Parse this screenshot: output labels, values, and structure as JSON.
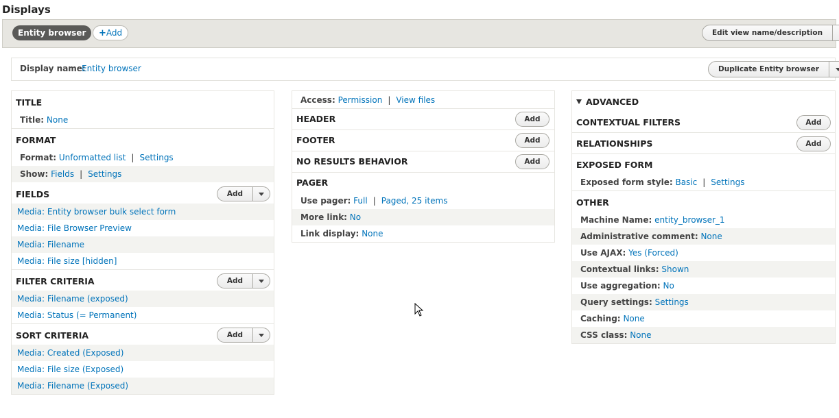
{
  "page_title": "Displays",
  "tabs": {
    "current": "Entity browser",
    "add": "Add"
  },
  "edit_button": "Edit view name/description",
  "display_name": {
    "label": "Display name:",
    "value": "Entity browser"
  },
  "duplicate_button": "Duplicate Entity browser",
  "left": {
    "title": {
      "header": "TITLE",
      "label": "Title:",
      "value": "None"
    },
    "format": {
      "header": "FORMAT",
      "format_label": "Format:",
      "format_value": "Unformatted list",
      "format_settings": "Settings",
      "show_label": "Show:",
      "show_value": "Fields",
      "show_settings": "Settings"
    },
    "fields": {
      "header": "FIELDS",
      "add": "Add",
      "items": [
        "Media: Entity browser bulk select form",
        "Media: File Browser Preview",
        "Media: Filename",
        "Media: File size [hidden]"
      ]
    },
    "filter": {
      "header": "FILTER CRITERIA",
      "add": "Add",
      "items": [
        "Media: Filename (exposed)",
        "Media: Status (= Permanent)"
      ]
    },
    "sort": {
      "header": "SORT CRITERIA",
      "add": "Add",
      "items": [
        "Media: Created (Exposed)",
        "Media: File size (Exposed)",
        "Media: Filename (Exposed)"
      ]
    }
  },
  "middle": {
    "access_label": "Access:",
    "access_value": "Permission",
    "access_extra": "View files",
    "header": {
      "title": "HEADER",
      "add": "Add"
    },
    "footer": {
      "title": "FOOTER",
      "add": "Add"
    },
    "no_results": {
      "title": "NO RESULTS BEHAVIOR",
      "add": "Add"
    },
    "pager": {
      "title": "PAGER",
      "use_label": "Use pager:",
      "use_value": "Full",
      "use_extra": "Paged, 25 items",
      "more_label": "More link:",
      "more_value": "No",
      "link_label": "Link display:",
      "link_value": "None"
    }
  },
  "right": {
    "advanced": "ADVANCED",
    "contextual": {
      "title": "CONTEXTUAL FILTERS",
      "add": "Add"
    },
    "relationships": {
      "title": "RELATIONSHIPS",
      "add": "Add"
    },
    "exposed": {
      "title": "EXPOSED FORM",
      "label": "Exposed form style:",
      "value": "Basic",
      "settings": "Settings"
    },
    "other": {
      "title": "OTHER",
      "rows": [
        {
          "label": "Machine Name:",
          "value": "entity_browser_1"
        },
        {
          "label": "Administrative comment:",
          "value": "None"
        },
        {
          "label": "Use AJAX:",
          "value": "Yes (Forced)"
        },
        {
          "label": "Contextual links:",
          "value": "Shown"
        },
        {
          "label": "Use aggregation:",
          "value": "No"
        },
        {
          "label": "Query settings:",
          "value": "Settings"
        },
        {
          "label": "Caching:",
          "value": "None"
        },
        {
          "label": "CSS class:",
          "value": "None"
        }
      ]
    }
  }
}
